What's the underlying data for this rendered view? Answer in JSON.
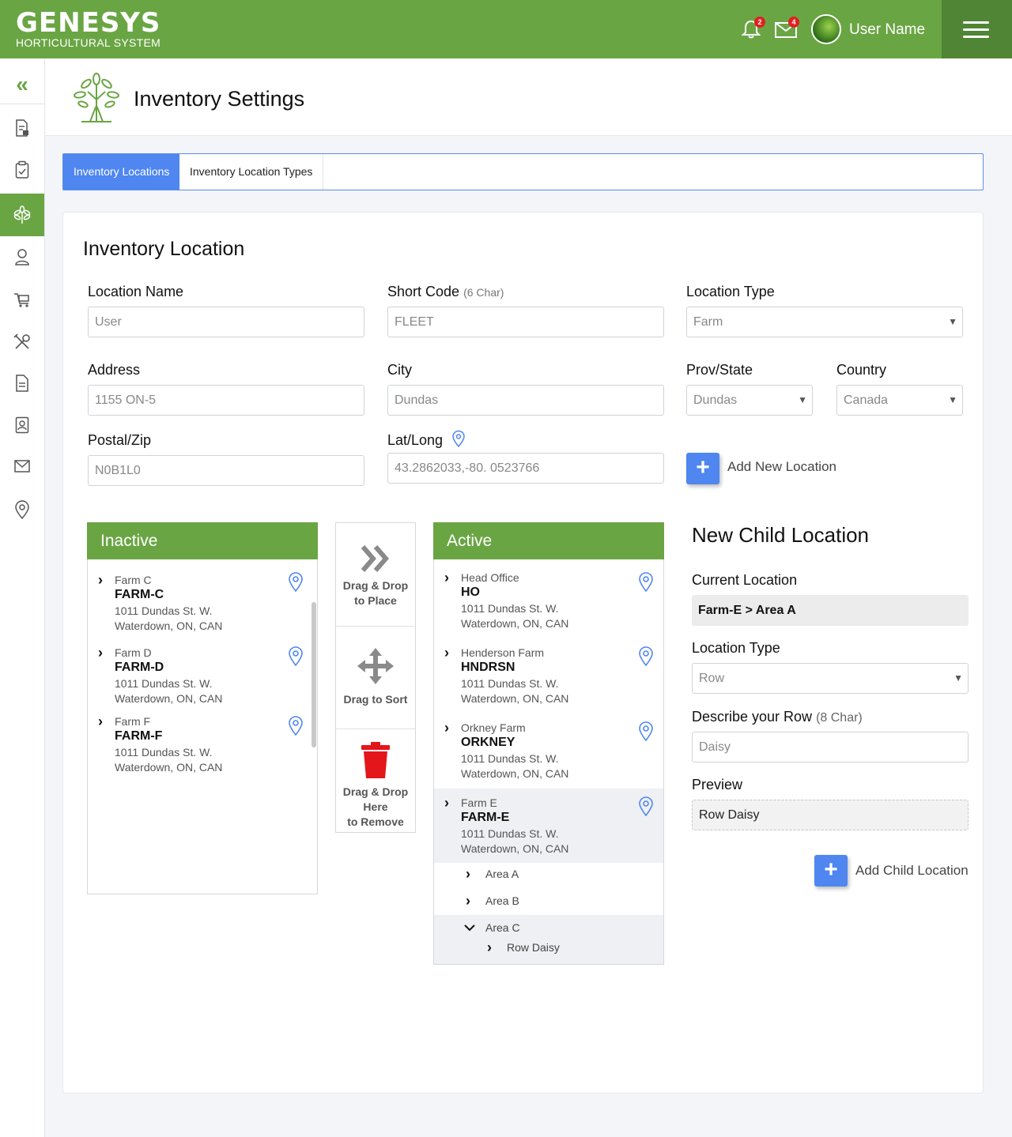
{
  "header": {
    "brand": "GENESYS",
    "brand_sub": "HORTICULTURAL SYSTEM",
    "notifications_count": "2",
    "messages_count": "4",
    "user_name": "User Name"
  },
  "sidebar": {
    "collapse_glyph": "«",
    "items": [
      {
        "icon": "report-icon"
      },
      {
        "icon": "clipboard-check-icon"
      },
      {
        "icon": "plant-icon",
        "active": true
      },
      {
        "icon": "user-icon"
      },
      {
        "icon": "cart-icon"
      },
      {
        "icon": "tools-icon"
      },
      {
        "icon": "document-icon"
      },
      {
        "icon": "contact-book-icon"
      },
      {
        "icon": "mail-icon"
      },
      {
        "icon": "location-pin-icon"
      }
    ]
  },
  "page": {
    "title": "Inventory Settings"
  },
  "tabs": [
    {
      "label": "Inventory Locations",
      "active": true
    },
    {
      "label": "Inventory Location Types",
      "active": false
    }
  ],
  "form": {
    "title": "Inventory Location",
    "location_name": {
      "label": "Location Name",
      "placeholder": "User"
    },
    "short_code": {
      "label": "Short Code",
      "hint": "(6 Char)",
      "placeholder": "FLEET"
    },
    "location_type": {
      "label": "Location Type",
      "value": "Farm"
    },
    "address": {
      "label": "Address",
      "placeholder": "1155 ON-5"
    },
    "city": {
      "label": "City",
      "placeholder": "Dundas"
    },
    "prov_state": {
      "label": "Prov/State",
      "value": "Dundas"
    },
    "country": {
      "label": "Country",
      "value": "Canada"
    },
    "postal": {
      "label": "Postal/Zip",
      "placeholder": "N0B1L0"
    },
    "latlong": {
      "label": "Lat/Long",
      "placeholder": "43.2862033,-80. 0523766"
    },
    "add_new_location": "Add New Location"
  },
  "inactive": {
    "title": "Inactive",
    "items": [
      {
        "name": "Farm C",
        "code": "FARM-C",
        "addr1": "1011 Dundas St. W.",
        "addr2": "Waterdown, ON, CAN"
      },
      {
        "name": "Farm D",
        "code": "FARM-D",
        "addr1": "1011 Dundas St. W.",
        "addr2": "Waterdown, ON, CAN"
      },
      {
        "name": "Farm F",
        "code": "FARM-F",
        "addr1": "1011 Dundas St. W.",
        "addr2": "Waterdown, ON, CAN"
      }
    ]
  },
  "actions": {
    "place_line1": "Drag & Drop",
    "place_line2": "to Place",
    "sort": "Drag to Sort",
    "remove_line1": "Drag & Drop",
    "remove_line2": "Here",
    "remove_line3": "to Remove"
  },
  "active": {
    "title": "Active",
    "items": [
      {
        "name": "Head Office",
        "code": "HO",
        "addr1": "1011 Dundas St. W.",
        "addr2": "Waterdown, ON, CAN"
      },
      {
        "name": "Henderson Farm",
        "code": "HNDRSN",
        "addr1": "1011 Dundas St. W.",
        "addr2": "Waterdown, ON, CAN"
      },
      {
        "name": "Orkney Farm",
        "code": "ORKNEY",
        "addr1": "1011 Dundas St. W.",
        "addr2": "Waterdown, ON, CAN"
      },
      {
        "name": "Farm E",
        "code": "FARM-E",
        "addr1": "1011 Dundas St. W.",
        "addr2": "Waterdown, ON, CAN"
      }
    ],
    "children": [
      "Area A",
      "Area B",
      "Area C"
    ],
    "grandchild": "Row Daisy"
  },
  "child": {
    "title": "New Child Location",
    "current_label": "Current Location",
    "current_value": "Farm-E > Area A",
    "type_label": "Location Type",
    "type_value": "Row",
    "describe_label": "Describe your Row",
    "describe_hint": "(8 Char)",
    "describe_placeholder": "Daisy",
    "preview_label": "Preview",
    "preview_value": "Row Daisy",
    "add_child": "Add Child Location"
  },
  "colors": {
    "brand_green": "#6aa544",
    "accent_blue": "#4f86f0",
    "pin_blue": "#4f86f0",
    "trash_red": "#e3161b"
  }
}
